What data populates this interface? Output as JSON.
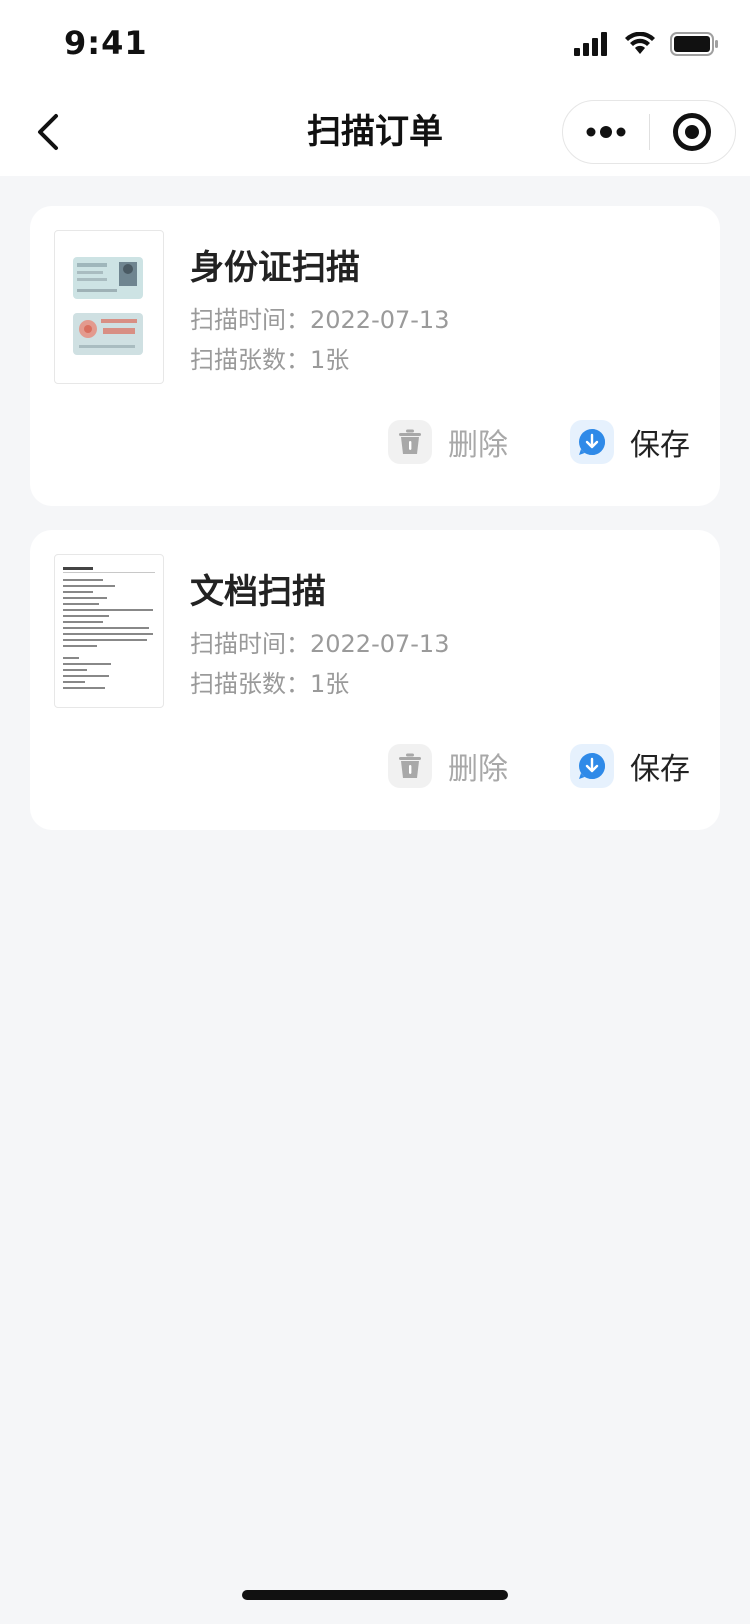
{
  "status_bar": {
    "time": "9:41"
  },
  "nav": {
    "title": "扫描订单"
  },
  "orders": [
    {
      "title": "身份证扫描",
      "time_label": "扫描时间：2022-07-13",
      "count_label": "扫描张数：1张",
      "delete_label": "删除",
      "save_label": "保存",
      "thumb_type": "id-card"
    },
    {
      "title": "文档扫描",
      "time_label": "扫描时间：2022-07-13",
      "count_label": "扫描张数：1张",
      "delete_label": "删除",
      "save_label": "保存",
      "thumb_type": "document"
    }
  ],
  "colors": {
    "accent": "#2f8ae8",
    "muted": "#9a9a9a",
    "background": "#f5f6f8"
  }
}
